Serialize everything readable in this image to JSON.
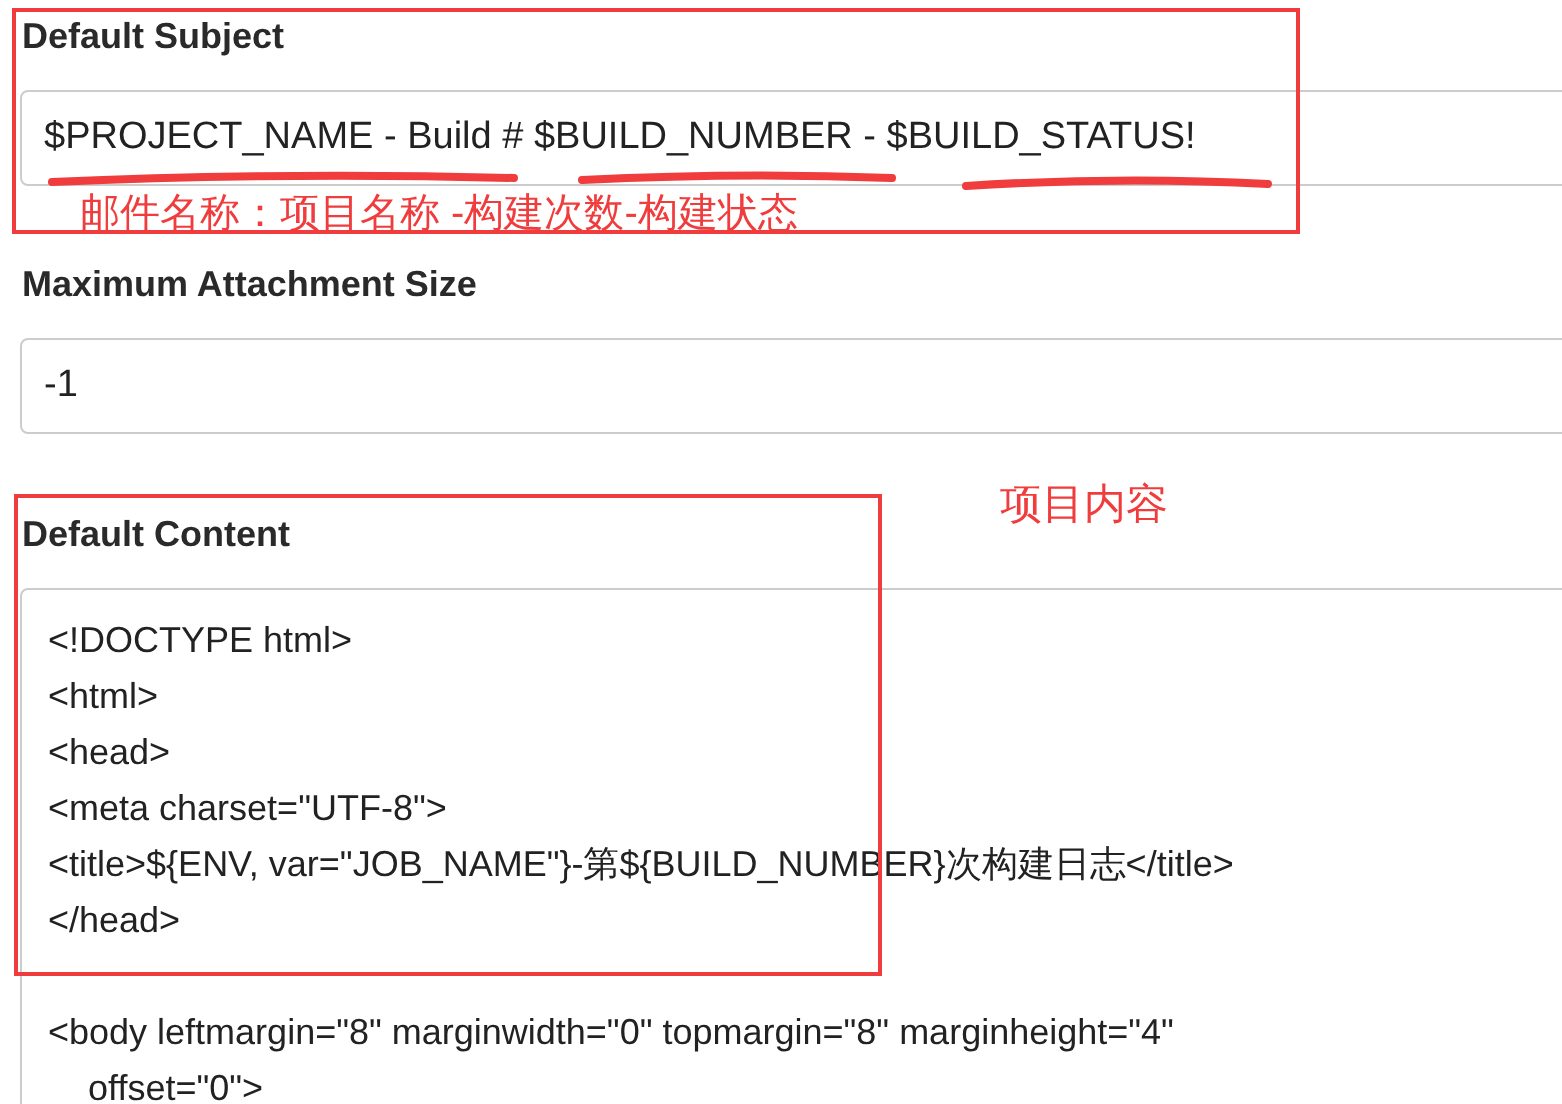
{
  "fields": [
    {
      "label": "Default Subject",
      "kind": "input",
      "value": "$PROJECT_NAME - Build # $BUILD_NUMBER - $BUILD_STATUS!"
    },
    {
      "label": "Maximum Attachment Size",
      "kind": "input",
      "value": "-1"
    },
    {
      "label": "Default Content",
      "kind": "textarea",
      "value": "<!DOCTYPE html>\n<html>\n<head>\n<meta charset=\"UTF-8\">\n<title>${ENV, var=\"JOB_NAME\"}-第${BUILD_NUMBER}次构建日志</title>\n</head>\n\n<body leftmargin=\"8\" marginwidth=\"0\" topmargin=\"8\" marginheight=\"4\"\n    offset=\"0\">"
    }
  ],
  "annotations": [
    {
      "text": "邮件名称：项目名称 -构建次数-构建状态"
    },
    {
      "text": "项目内容"
    }
  ]
}
